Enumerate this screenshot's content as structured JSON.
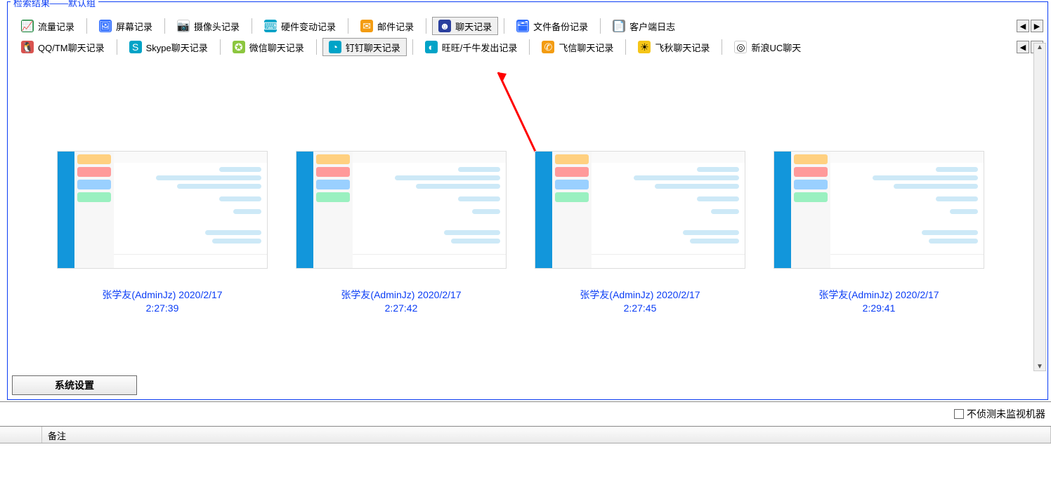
{
  "group_title": "检索结果——默认组",
  "row1": {
    "items": [
      {
        "id": "traffic-record",
        "label": "流量记录",
        "icon": "📈",
        "cls": "ic-green"
      },
      {
        "id": "screen-record",
        "label": "屏幕记录",
        "icon": "🖼",
        "cls": "ic-blue"
      },
      {
        "id": "camera-record",
        "label": "摄像头记录",
        "icon": "📷",
        "cls": "ic-white"
      },
      {
        "id": "hw-change-record",
        "label": "硬件变动记录",
        "icon": "⌨",
        "cls": "ic-teal"
      },
      {
        "id": "mail-record",
        "label": "邮件记录",
        "icon": "✉",
        "cls": "ic-orange"
      },
      {
        "id": "chat-record",
        "label": "聊天记录",
        "icon": "☻",
        "cls": "ic-navy",
        "active": true
      },
      {
        "id": "file-backup-record",
        "label": "文件备份记录",
        "icon": "🗂",
        "cls": "ic-blue"
      },
      {
        "id": "client-log",
        "label": "客户端日志",
        "icon": "📄",
        "cls": "ic-gray"
      }
    ]
  },
  "row2": {
    "items": [
      {
        "id": "qq-tm-chat",
        "label": "QQ/TM聊天记录",
        "icon": "🐧",
        "cls": "ic-red"
      },
      {
        "id": "skype-chat",
        "label": "Skype聊天记录",
        "icon": "S",
        "cls": "ic-teal"
      },
      {
        "id": "wechat-chat",
        "label": "微信聊天记录",
        "icon": "✪",
        "cls": "ic-lime"
      },
      {
        "id": "ding-chat",
        "label": "钉钉聊天记录",
        "icon": "◔",
        "cls": "ic-teal",
        "active": true
      },
      {
        "id": "wangwang-chat",
        "label": "旺旺/千牛发出记录",
        "icon": "◐",
        "cls": "ic-teal"
      },
      {
        "id": "feixin-chat",
        "label": "飞信聊天记录",
        "icon": "✆",
        "cls": "ic-orange"
      },
      {
        "id": "feiqiu-chat",
        "label": "飞秋聊天记录",
        "icon": "☀",
        "cls": "ic-yellow"
      },
      {
        "id": "sina-uc-chat",
        "label": "新浪UC聊天",
        "icon": "◎",
        "cls": "ic-white"
      }
    ]
  },
  "thumbs": [
    {
      "caption": "张学友(AdminJz) 2020/2/17\n2:27:39"
    },
    {
      "caption": "张学友(AdminJz) 2020/2/17\n2:27:42"
    },
    {
      "caption": "张学友(AdminJz) 2020/2/17\n2:27:45"
    },
    {
      "caption": "张学友(AdminJz) 2020/2/17\n2:29:41"
    }
  ],
  "sys_button": "系统设置",
  "checkbox_label": "不侦测未监视机器",
  "table": {
    "col_remark": "备注"
  },
  "nav_arrows": {
    "left": "◀",
    "right": "▶"
  }
}
